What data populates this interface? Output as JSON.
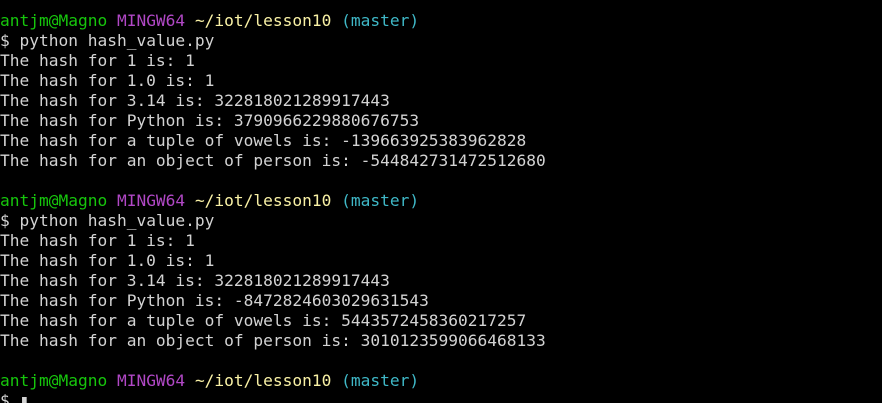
{
  "colors": {
    "background": "#000000",
    "text": "#d3d3d3",
    "user_host": "#16c60c",
    "system": "#b148c6",
    "path": "#f9f1a5",
    "branch": "#3fb8c7"
  },
  "prompt": {
    "user_host": "antjm@Magno",
    "system": "MINGW64",
    "path": "~/iot/lesson10",
    "branch": "(master)",
    "symbol": "$"
  },
  "runs": [
    {
      "command": "python hash_value.py",
      "output": [
        "The hash for 1 is: 1",
        "The hash for 1.0 is: 1",
        "The hash for 3.14 is: 322818021289917443",
        "The hash for Python is: 3790966229880676753",
        "The hash for a tuple of vowels is: -139663925383962828",
        "The hash for an object of person is: -544842731472512680"
      ]
    },
    {
      "command": "python hash_value.py",
      "output": [
        "The hash for 1 is: 1",
        "The hash for 1.0 is: 1",
        "The hash for 3.14 is: 322818021289917443",
        "The hash for Python is: -8472824603029631543",
        "The hash for a tuple of vowels is: 5443572458360217257",
        "The hash for an object of person is: 3010123599066468133"
      ]
    }
  ]
}
